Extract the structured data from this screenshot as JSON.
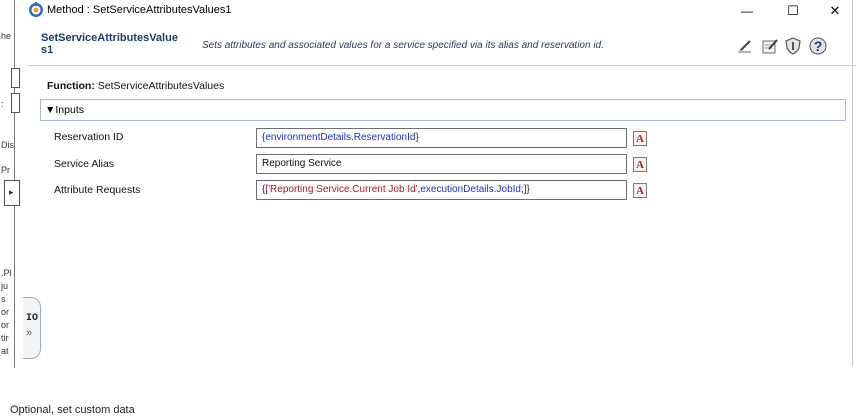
{
  "window": {
    "title": "Method : SetServiceAttributesValues1",
    "minimize_label": "—",
    "maximize_label": "☐",
    "close_label": "✕"
  },
  "header": {
    "method_name": "SetServiceAttributesValue s1",
    "description": "Sets attributes and associated values for a service specified via its alias and reservation id.",
    "icons": [
      "pencil-icon",
      "edit-document-icon",
      "shield-icon",
      "help-icon"
    ]
  },
  "function": {
    "prefix": "Function:",
    "name": "SetServiceAttributesValues"
  },
  "inputs": {
    "label": "▼Inputs",
    "rows": [
      {
        "label": "Reservation ID",
        "value_parts": [
          {
            "text": "{",
            "kind": "brace"
          },
          {
            "text": "environmentDetails",
            "kind": "var"
          },
          {
            "text": ".ReservationId",
            "kind": "blue"
          },
          {
            "text": "}",
            "kind": "brace"
          }
        ]
      },
      {
        "label": "Service Alias",
        "value_parts": [
          {
            "text": "Reporting Service",
            "kind": "plain"
          }
        ]
      },
      {
        "label": "Attribute Requests",
        "value_parts": [
          {
            "text": "{",
            "kind": "brace"
          },
          {
            "text": "['Reporting Service.Current Job Id'",
            "kind": "str"
          },
          {
            "text": ",",
            "kind": "brace"
          },
          {
            "text": "executionDetails",
            "kind": "var"
          },
          {
            "text": ".JobId",
            "kind": "blue"
          },
          {
            "text": ";]}",
            "kind": "brace"
          }
        ]
      }
    ],
    "expression_button_glyph": "A"
  },
  "io_tab": {
    "label": "IO",
    "chevron": "»"
  },
  "left_strip": {
    "fragments": [
      "he",
      ":",
      "Dis",
      "Pr",
      "▸",
      ".Pl",
      "ju",
      "s",
      "or",
      "or",
      "tir",
      "at"
    ]
  },
  "footer": {
    "text": "Optional, set custom data"
  }
}
